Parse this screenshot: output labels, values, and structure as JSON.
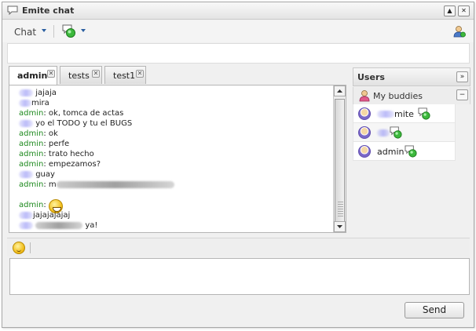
{
  "window": {
    "title": "Emite chat"
  },
  "toolbar": {
    "chat_label": "Chat"
  },
  "tabs": [
    {
      "label": "admin",
      "active": true
    },
    {
      "label": "tests",
      "active": false
    },
    {
      "label": "test1",
      "active": false
    }
  ],
  "messages": [
    {
      "nick": "",
      "text": "jajaja"
    },
    {
      "nick": "",
      "text": "mira"
    },
    {
      "nick": "admin",
      "text": "ok, tomca de actas"
    },
    {
      "nick": "",
      "text": "yo el TODO y tu el BUGS"
    },
    {
      "nick": "admin",
      "text": "ok"
    },
    {
      "nick": "admin",
      "text": "perfe"
    },
    {
      "nick": "admin",
      "text": "trato hecho"
    },
    {
      "nick": "admin",
      "text": "empezamos?"
    },
    {
      "nick": "",
      "text": "guay"
    },
    {
      "nick": "admin",
      "text": "m"
    },
    {
      "nick": "admin",
      "text": ""
    },
    {
      "nick": "",
      "text": "jajajajajaj"
    },
    {
      "nick": "",
      "text": "ya!"
    }
  ],
  "users_panel": {
    "title": "Users",
    "group_label": "My buddies"
  },
  "buddies": [
    {
      "name": "mite"
    },
    {
      "name": ""
    },
    {
      "name": "admin"
    }
  ],
  "input": {
    "value": ""
  },
  "send_button": {
    "label": "Send"
  },
  "colors": {
    "nick": "#1e8a1e",
    "status_online": "#3cb83c",
    "accent": "#2a5ea0"
  }
}
